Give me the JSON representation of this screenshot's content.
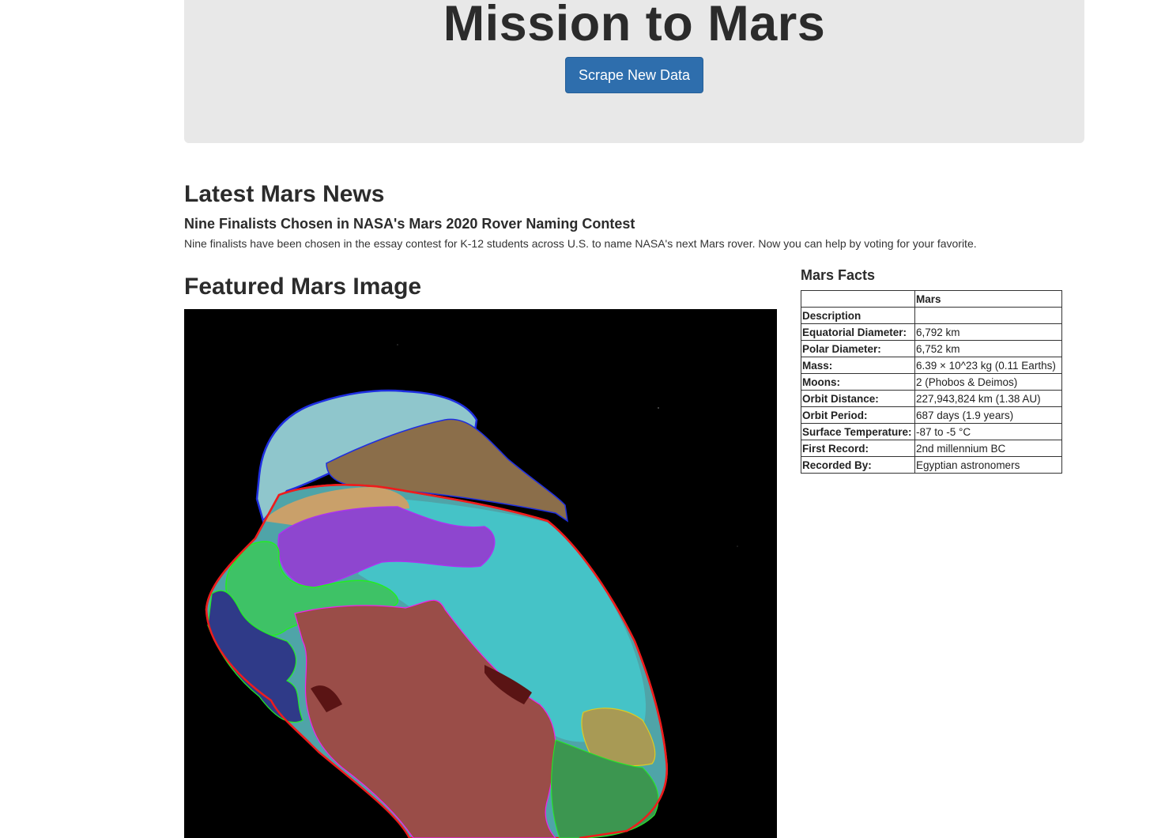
{
  "header": {
    "title": "Mission to Mars",
    "scrape_button": "Scrape New Data"
  },
  "news": {
    "heading": "Latest Mars News",
    "title": "Nine Finalists Chosen in NASA's Mars 2020 Rover Naming Contest",
    "paragraph": "Nine finalists have been chosen in the essay contest for K-12 students across U.S. to name NASA's next Mars rover. Now you can help by voting for your favorite."
  },
  "featured": {
    "heading": "Featured Mars Image"
  },
  "facts": {
    "heading": "Mars Facts",
    "column_header": "Mars",
    "rows": [
      {
        "label": "Description",
        "value": ""
      },
      {
        "label": "Equatorial Diameter:",
        "value": "6,792 km"
      },
      {
        "label": "Polar Diameter:",
        "value": "6,752 km"
      },
      {
        "label": "Mass:",
        "value": "6.39 × 10^23 kg (0.11 Earths)"
      },
      {
        "label": "Moons:",
        "value": "2 (Phobos & Deimos)"
      },
      {
        "label": "Orbit Distance:",
        "value": "227,943,824 km (1.38 AU)"
      },
      {
        "label": "Orbit Period:",
        "value": "687 days (1.9 years)"
      },
      {
        "label": "Surface Temperature:",
        "value": "-87 to -5 °C"
      },
      {
        "label": "First Record:",
        "value": "2nd millennium BC"
      },
      {
        "label": "Recorded By:",
        "value": "Egyptian astronomers"
      }
    ]
  }
}
